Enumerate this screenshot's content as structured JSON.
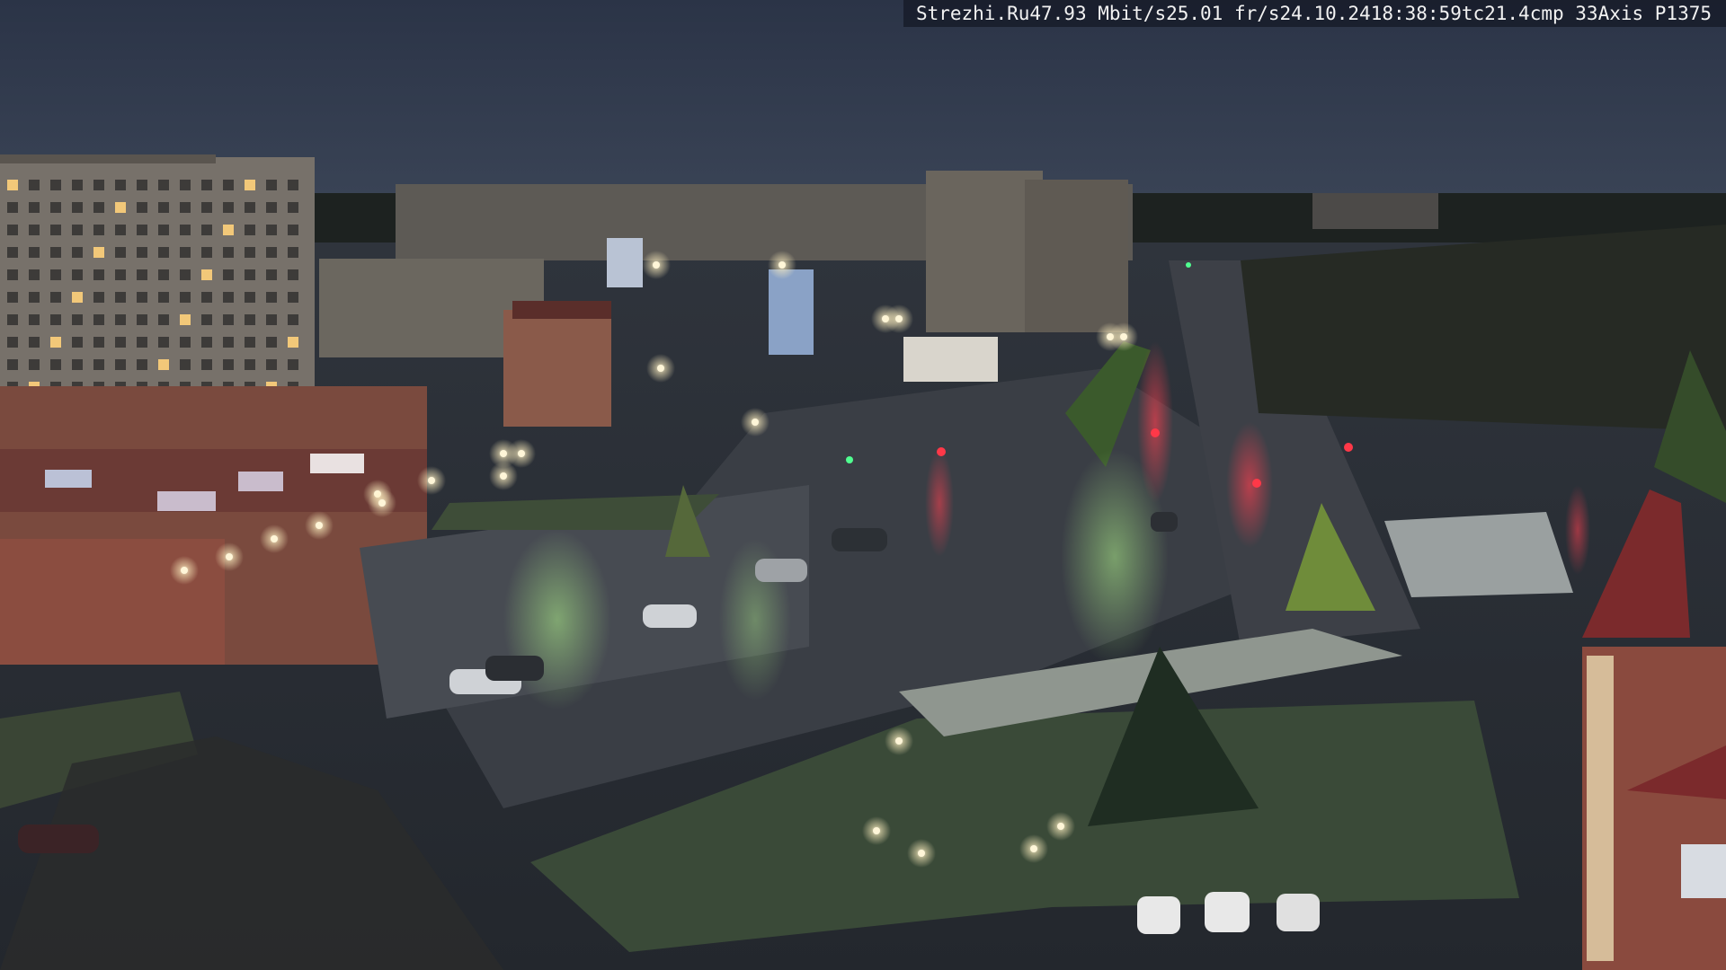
{
  "overlay": {
    "site": "Strezhi.Ru",
    "bitrate": "47.93 Mbit/s",
    "framerate": "25.01 fr/s",
    "date": "24.10.24",
    "time": "18:38:59",
    "tc": "tc21.4",
    "cmp": "cmp 33",
    "camera": "Axis P1375"
  },
  "scene": {
    "description_icon": "webcam-night-city-square",
    "sky_color": "#28334a",
    "road_color": "#3a3f47",
    "building_color": "#7b7468",
    "light_color": "#fff6d8"
  }
}
